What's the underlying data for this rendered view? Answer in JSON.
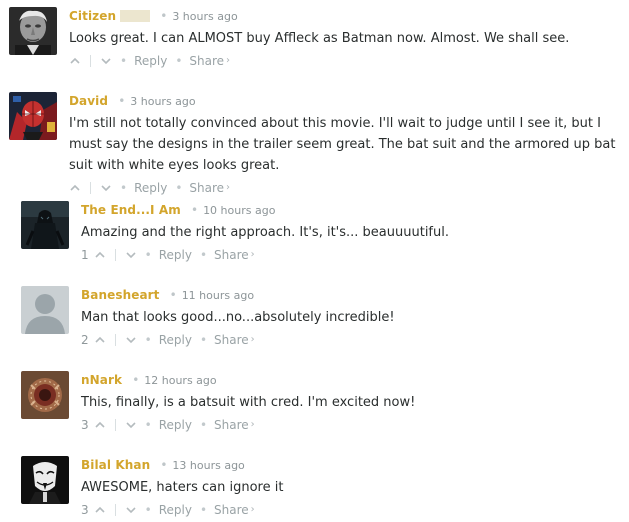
{
  "comments": [
    {
      "author": "Citizen",
      "time": "3 hours ago",
      "text": "Looks great. I can ALMOST buy Affleck as Batman now. Almost. We shall see.",
      "votes": "",
      "avatar_icon": "old-man-portrait-avatar"
    },
    {
      "author": "David",
      "time": "3 hours ago",
      "text": "I'm still not totally convinced about this movie. I'll wait to judge until I see it, but I must say the designs in the trailer seem great. The bat suit and the armored up bat suit with white eyes looks great.",
      "votes": "",
      "avatar_icon": "superhero-avatar"
    },
    {
      "author": "The End...I Am",
      "time": "10 hours ago",
      "text": "Amazing and the right approach. It's, it's... beauuuutiful.",
      "votes": "1",
      "avatar_icon": "dark-figure-avatar"
    },
    {
      "author": "Banesheart",
      "time": "11 hours ago",
      "text": "Man that looks good...no...absolutely incredible!",
      "votes": "2",
      "avatar_icon": "default-user-avatar"
    },
    {
      "author": "nNark",
      "time": "12 hours ago",
      "text": "This, finally, is a batsuit with cred. I'm excited now!",
      "votes": "3",
      "avatar_icon": "creature-avatar"
    },
    {
      "author": "Bilal Khan",
      "time": "13 hours ago",
      "text": "AWESOME, haters can ignore it",
      "votes": "3",
      "avatar_icon": "mask-avatar"
    }
  ],
  "actions": {
    "bullet": "•",
    "reply": "Reply",
    "share": "Share",
    "share_chevron": "›"
  },
  "colors": {
    "author": "#d3a52c",
    "text": "#2a2e2e",
    "muted": "#9aa3a6"
  }
}
